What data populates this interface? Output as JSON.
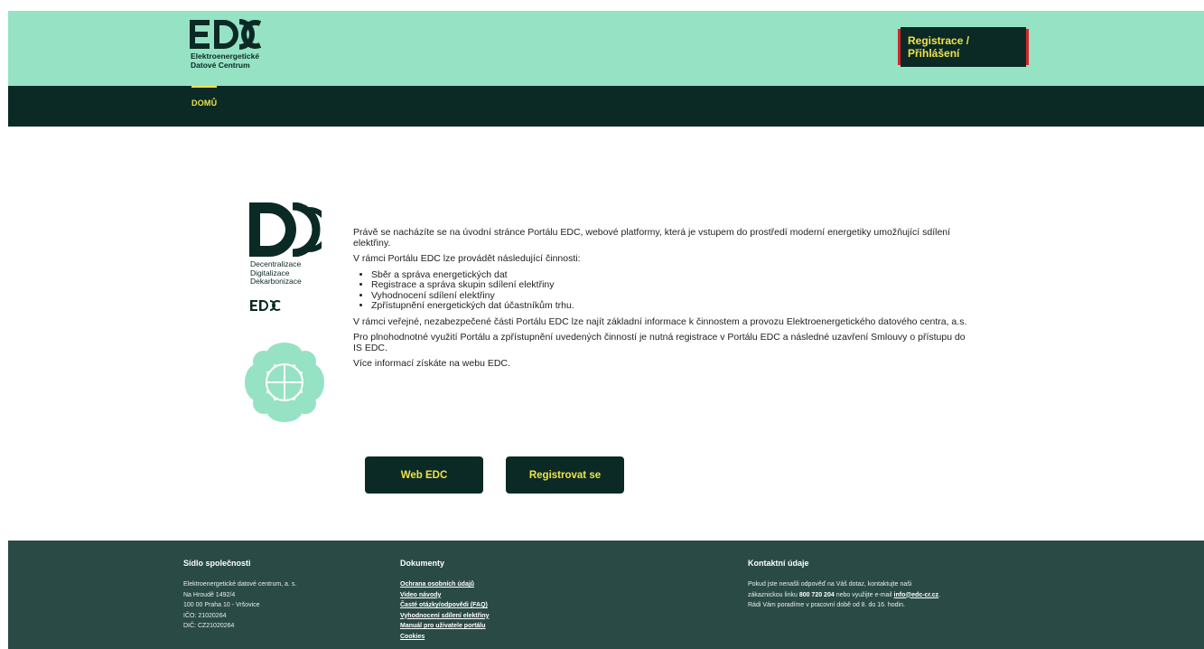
{
  "header": {
    "logo_text": "Elektroenergetické\nDatové Centrum",
    "login_button": "Registrace / Přihlášení",
    "brand_color": "#96e2c4",
    "dark_color": "#0b2a25",
    "accent_color": "#f0e24a",
    "highlight_border_color": "#d8252b"
  },
  "nav": {
    "items": [
      {
        "label": "DOMŮ"
      }
    ]
  },
  "sidebar": {
    "ddd_text": "Decentralizace\nDigitalizace\nDekarbonizace",
    "edc_icon": "edc-logo-icon",
    "flower_icon": "flower-icon"
  },
  "content": {
    "intro": "Právě se nacházíte se na úvodní stránce Portálu EDC, webové platformy, která je vstupem do prostředí moderní energetiky umožňující sdílení elektřiny.",
    "activities_heading": "V rámci Portálu EDC lze provádět následující činnosti:",
    "activities": [
      "Sběr a správa energetických dat",
      "Registrace a správa skupin sdílení elektřiny",
      "Vyhodnocení sdílení elektřiny",
      "Zpřístupnění energetických dat účastníkům trhu."
    ],
    "public_info": "V rámci veřejné, nezabezpečené části Portálu EDC lze najít základní informace k činnostem a provozu Elektroenergetického datového centra, a.s.",
    "registration_info": "Pro plnohodnotné využití Portálu a zpřístupnění uvedených činností je nutná registrace v Portálu EDC a následné uzavření Smlouvy o přístupu do IS EDC.",
    "more_info": "Více informací získáte na webu EDC.",
    "web_button": "Web EDC",
    "register_button": "Registrovat se"
  },
  "footer": {
    "company": {
      "title": "Sídlo společnosti",
      "lines": [
        "Elektroenergetické datové centrum, a. s.",
        "Na Hroudě 1492/4",
        "100 00 Praha 10 - Vršovice",
        "IČO: 21020264",
        "DIČ: CZ21020264"
      ]
    },
    "documents": {
      "title": "Dokumenty",
      "links": [
        "Ochrana osobních údajů",
        "Video návody",
        "Časté otázky/odpovědi (FAQ)",
        "Vyhodnocení sdílení elektřiny",
        "Manuál pro uživatele portálu",
        "Cookies"
      ]
    },
    "contact": {
      "title": "Kontaktní údaje",
      "line1": "Pokud jste nenašli odpověď na Váš dotaz, kontaktujte naši",
      "line2_pre": "zákaznickou linku ",
      "phone": "800 720 204",
      "line2_mid": " nebo využijte e-mail ",
      "email": "info@edc-cr.cz",
      "line2_post": ".",
      "line3": "Rádi Vám poradíme v pracovní době od 8. do 16. hodin."
    }
  }
}
